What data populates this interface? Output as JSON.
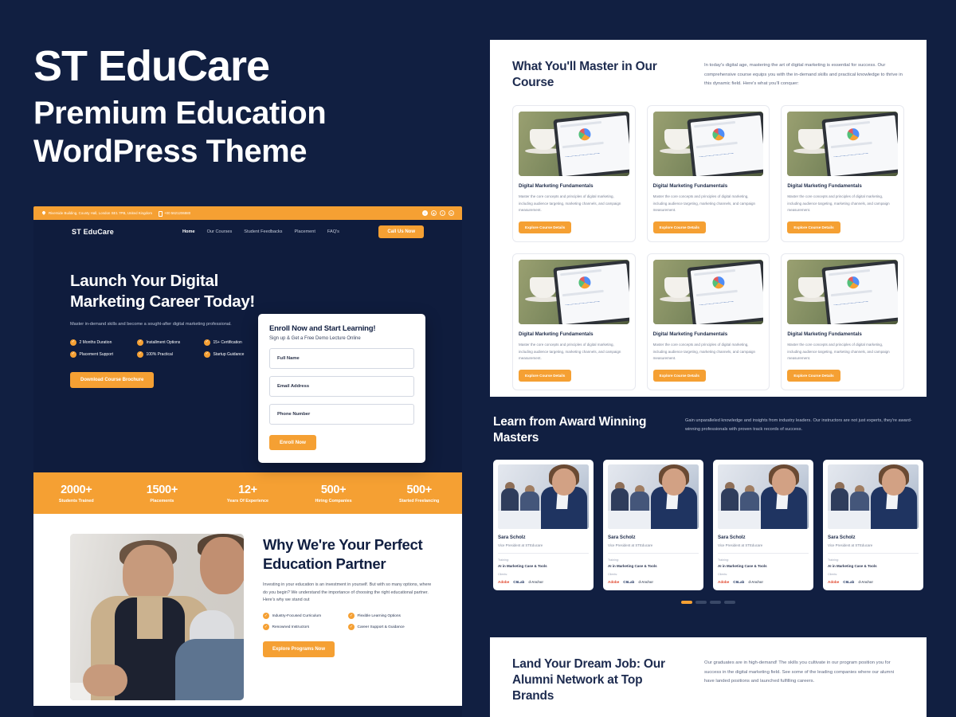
{
  "promo": {
    "brand": "ST EduCare",
    "subtitle_line1": "Premium Education",
    "subtitle_line2": "WordPress Theme"
  },
  "colors": {
    "background": "#111f41",
    "accent_orange": "#f5a033",
    "panel_white": "#ffffff",
    "navy_text": "#1d2b4f"
  },
  "mockup": {
    "topbar": {
      "address": "Riverside Building, County Hall, London SE1 7PB, United Kingdom",
      "phone": "+00 5621206880",
      "address_icon": "location-pin-icon",
      "phone_icon": "phone-icon",
      "socials": [
        "twitter-icon",
        "instagram-icon",
        "facebook-icon",
        "linkedin-icon"
      ]
    },
    "nav": {
      "logo": "ST EduCare",
      "links": [
        "Home",
        "Our Courses",
        "Student Feedbacks",
        "Placement",
        "FAQ's"
      ],
      "active_link": "Home",
      "cta": "Call Us Now"
    },
    "hero": {
      "heading": "Launch Your Digital Marketing Career Today!",
      "paragraph": "Master in-demand skills and become a sought-after digital marketing professional.",
      "features": [
        "2 Months Duration",
        "Installment Options",
        "15+ Certification",
        "Placement Support",
        "100% Practical",
        "Startup Guidance"
      ],
      "button": "Download Course Brochure",
      "form": {
        "title": "Enroll Now and Start Learning!",
        "subtitle": "Sign up & Get a Free Demo Lecture Online",
        "fields": [
          {
            "placeholder": "Full Name"
          },
          {
            "placeholder": "Email Address"
          },
          {
            "placeholder": "Phone Number"
          }
        ],
        "submit": "Enroll Now"
      }
    },
    "stats": [
      {
        "number": "2000+",
        "label": "Students Trained"
      },
      {
        "number": "1500+",
        "label": "Placements"
      },
      {
        "number": "12+",
        "label": "Years Of Experience"
      },
      {
        "number": "500+",
        "label": "Hiring Companies"
      },
      {
        "number": "500+",
        "label": "Started Freelancing"
      }
    ],
    "why": {
      "heading": "Why We're Your Perfect Education Partner",
      "paragraph": "Investing in your education is an investment in yourself. But with so many options, where do you begin? We understand the importance of choosing the right educational partner. Here's why we stand out",
      "features": [
        "Industry-Focused Curriculum",
        "Flexible Learning Options",
        "Renowned Instructors",
        "Career Support & Guidance"
      ],
      "button": "Explore Programs Now"
    }
  },
  "courses_panel": {
    "heading": "What You'll Master in Our Course",
    "paragraph": "In today's digital age, mastering the art of digital marketing is essential for success. Our comprehensive course equips you with the in-demand skills and practical knowledge to thrive in this dynamic field. Here's what you'll conquer:",
    "cards": [
      {
        "title": "Digital Marketing Fundamentals",
        "description": "Master the core concepts and principles of digital marketing, including audience targeting, marketing channels, and campaign measurement.",
        "button": "Explore Course Details"
      },
      {
        "title": "Digital Marketing Fundamentals",
        "description": "Master the core concepts and principles of digital marketing, including audience targeting, marketing channels, and campaign measurement.",
        "button": "Explore Course Details"
      },
      {
        "title": "Digital Marketing Fundamentals",
        "description": "Master the core concepts and principles of digital marketing, including audience targeting, marketing channels, and campaign measurement.",
        "button": "Explore Course Details"
      },
      {
        "title": "Digital Marketing Fundamentals",
        "description": "Master the core concepts and principles of digital marketing, including audience targeting, marketing channels, and campaign measurement.",
        "button": "Explore Course Details"
      },
      {
        "title": "Digital Marketing Fundamentals",
        "description": "Master the core concepts and principles of digital marketing, including audience targeting, marketing channels, and campaign measurement.",
        "button": "Explore Course Details"
      },
      {
        "title": "Digital Marketing Fundamentals",
        "description": "Master the core concepts and principles of digital marketing, including audience targeting, marketing channels, and campaign measurement.",
        "button": "Explore Course Details"
      }
    ]
  },
  "instructors_section": {
    "heading": "Learn from Award Winning Masters",
    "paragraph": "Gain unparalleled knowledge and insights from industry leaders. Our instructors are not just experts, they're award-winning professionals with proven track records of success.",
    "training_label": "Training:",
    "clients_label": "Clients:",
    "cards": [
      {
        "name": "Sara Scholz",
        "role": "Vice President at STEducare",
        "training": "AI in Marketing Case & Tools",
        "logos": [
          "Adobe",
          "C6Lab",
          "d-Anchor"
        ]
      },
      {
        "name": "Sara Scholz",
        "role": "Vice President at STEducare",
        "training": "AI in Marketing Case & Tools",
        "logos": [
          "Adobe",
          "C6Lab",
          "d-Anchor"
        ]
      },
      {
        "name": "Sara Scholz",
        "role": "Vice President at STEducare",
        "training": "AI in Marketing Case & Tools",
        "logos": [
          "Adobe",
          "C6Lab",
          "d-Anchor"
        ]
      },
      {
        "name": "Sara Scholz",
        "role": "Vice President at STEducare",
        "training": "AI in Marketing Case & Tools",
        "logos": [
          "Adobe",
          "C6Lab",
          "d-Anchor"
        ]
      }
    ],
    "pagination": {
      "total": 4,
      "active_index": 0
    }
  },
  "alumni_panel": {
    "heading": "Land Your Dream Job: Our Alumni Network at Top Brands",
    "paragraph": "Our graduates are in high-demand! The skills you cultivate in our program position you for success in the digital marketing field. See some of the leading companies where our alumni have landed positions and launched fulfilling careers."
  }
}
